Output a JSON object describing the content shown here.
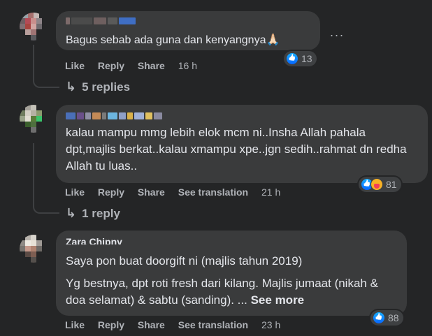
{
  "comments": [
    {
      "text": "Bagus sebab ada guna dan kenyangnya🙏🏻",
      "actions": [
        "Like",
        "Reply",
        "Share"
      ],
      "time": "16 h",
      "reaction_count": "13",
      "replies_label": "5 replies"
    },
    {
      "text": "kalau mampu mmg lebih elok mcm ni..Insha Allah pahala dpt,majlis berkat..kalau xmampu xpe..jgn sedih..rahmat dn redha Allah tu luas..",
      "actions": [
        "Like",
        "Reply",
        "Share",
        "See translation"
      ],
      "time": "21 h",
      "reaction_count": "81",
      "replies_label": "1 reply"
    },
    {
      "author": "Zara Chipny",
      "text_1": "Saya pon buat doorgift ni (majlis tahun 2019)",
      "text_2": "Yg bestnya, dpt roti fresh dari kilang. Majlis jumaat (nikah & doa selamat) & sabtu (sanding). ...",
      "see_more": "See more",
      "actions": [
        "Like",
        "Reply",
        "Share",
        "See translation"
      ],
      "time": "23 h",
      "reaction_count": "88"
    }
  ],
  "colors": {
    "background": "#242526",
    "bubble": "#3a3b3c",
    "text": "#e4e6eb",
    "secondary": "#b0b3b8",
    "like_blue": "#0866ff"
  }
}
